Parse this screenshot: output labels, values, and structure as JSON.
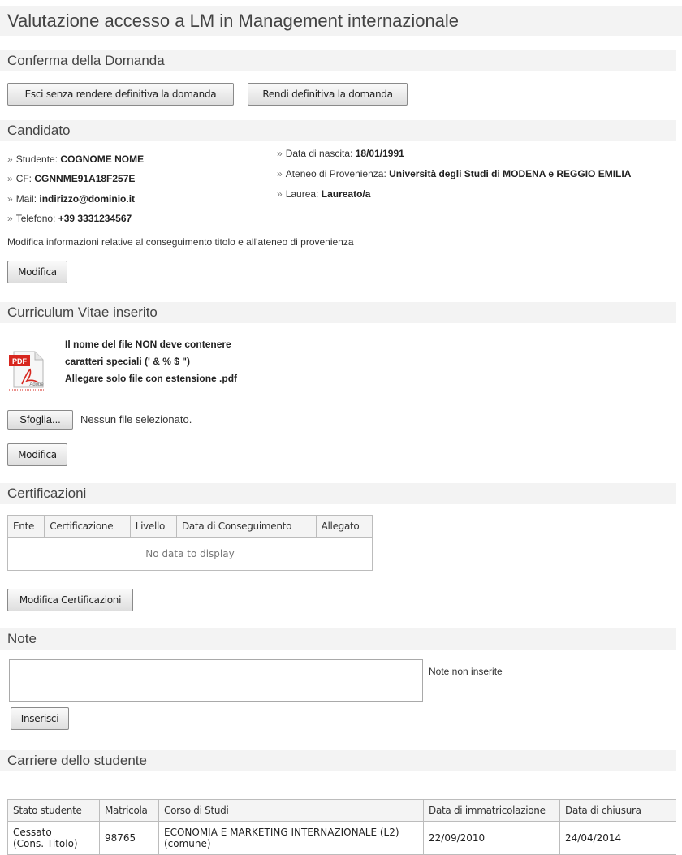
{
  "page": {
    "title": "Valutazione accesso a LM in Management internazionale"
  },
  "confirm": {
    "title": "Conferma della Domanda",
    "exit_label": "Esci senza rendere definitiva la domanda",
    "finalize_label": "Rendi definitiva la domanda"
  },
  "candidate": {
    "title": "Candidato",
    "left": [
      {
        "label": "Studente: ",
        "value": "COGNOME NOME"
      },
      {
        "label": "CF: ",
        "value": "CGNNME91A18F257E"
      },
      {
        "label": "Mail: ",
        "value": "indirizzo@dominio.it"
      },
      {
        "label": "Telefono: ",
        "value": "+39 3331234567"
      }
    ],
    "right": [
      {
        "label": "Data di nascita: ",
        "value": "18/01/1991"
      },
      {
        "label": "Ateneo di Provenienza: ",
        "value": "Università degli Studi di MODENA e REGGIO EMILIA"
      },
      {
        "label": "Laurea: ",
        "value": "Laureato/a"
      }
    ],
    "bullet": "»",
    "edit_info_text": "Modifica informazioni relative al conseguimento titolo e all'ateneo di provenienza",
    "edit_label": "Modifica"
  },
  "cv": {
    "title": "Curriculum Vitae inserito",
    "icon_text": "PDF",
    "icon_sub": "Adobe",
    "notice": [
      "Il nome del file NON deve contenere",
      "caratteri speciali (' & % $ \")",
      "Allegare solo file con estensione .pdf"
    ],
    "browse_label": "Sfoglia...",
    "file_status": "Nessun file selezionato.",
    "edit_label": "Modifica"
  },
  "certifications": {
    "title": "Certificazioni",
    "columns": [
      "Ente",
      "Certificazione",
      "Livello",
      "Data di Conseguimento",
      "Allegato"
    ],
    "empty_text": "No data to display",
    "edit_label": "Modifica Certificazioni"
  },
  "notes": {
    "title": "Note",
    "value": "",
    "status": "Note non inserite",
    "insert_label": "Inserisci"
  },
  "careers": {
    "title": "Carriere dello studente",
    "columns": [
      "Stato studente",
      "Matricola",
      "Corso di Studi",
      "Data di immatricolazione",
      "Data di chiusura"
    ],
    "rows": [
      {
        "stato": "Cessato",
        "stato_sub": "(Cons. Titolo)",
        "matricola": "98765",
        "corso": "ECONOMIA E MARKETING INTERNAZIONALE (L2)",
        "corso_sub": "(comune)",
        "immatricolazione": "22/09/2010",
        "chiusura": "24/04/2014"
      }
    ]
  }
}
